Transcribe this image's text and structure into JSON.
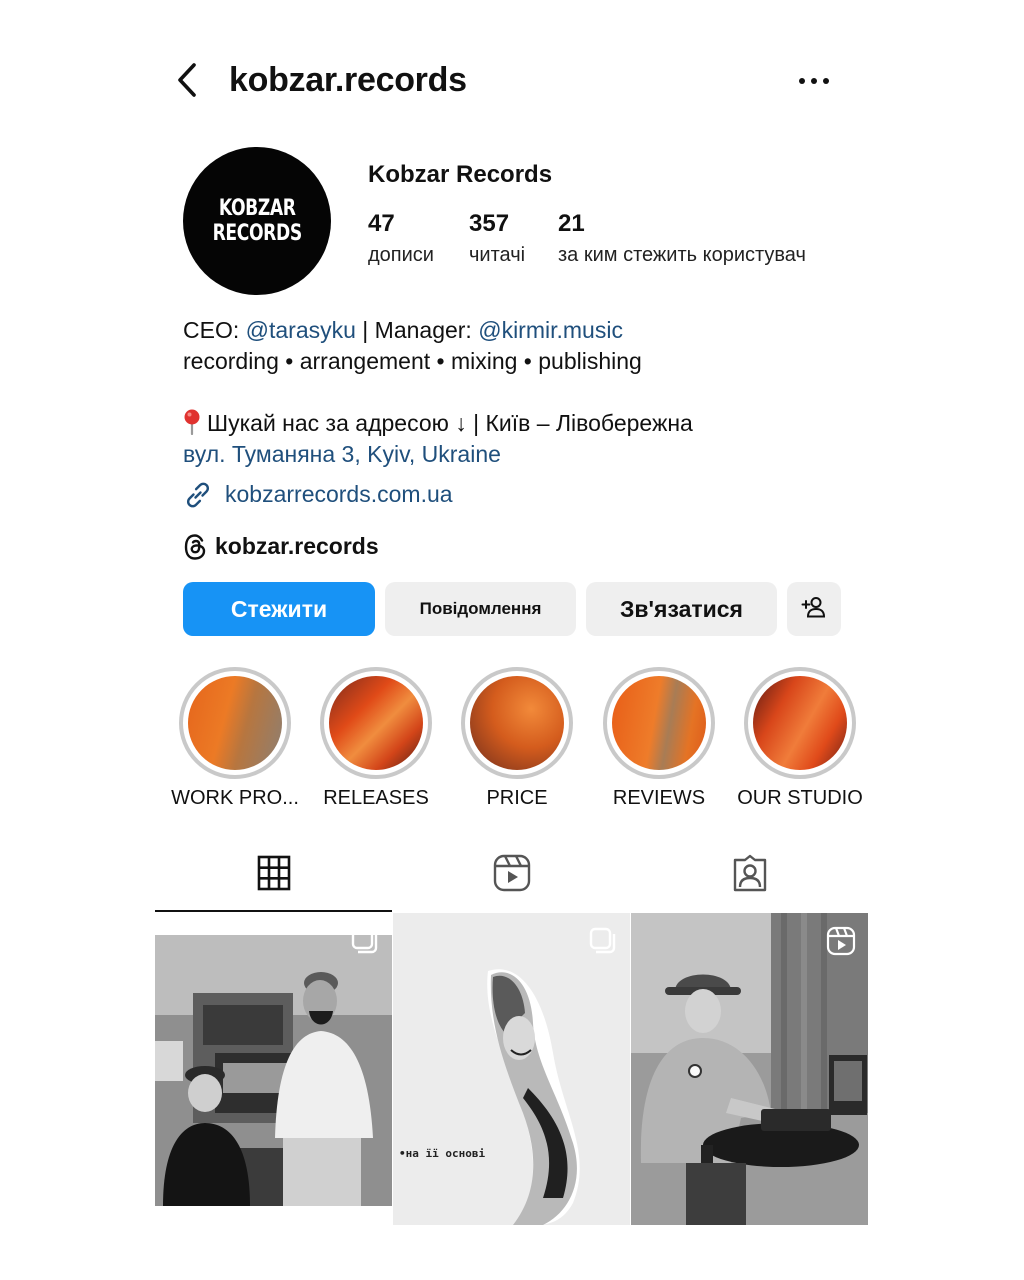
{
  "header": {
    "username": "kobzar.records"
  },
  "profile": {
    "avatar_text_line1": "KOBZAR",
    "avatar_text_line2": "RECORDS",
    "display_name": "Kobzar Records",
    "stats": [
      {
        "value": "47",
        "label": "дописи"
      },
      {
        "value": "357",
        "label": "читачі"
      },
      {
        "value": "21",
        "label": "за ким стежить користувач"
      }
    ]
  },
  "bio": {
    "line1_prefix": "CEO: ",
    "ceo_mention": "@tarasyku",
    "line1_middle": " | Manager: ",
    "manager_mention": "@kirmir.music",
    "line2": "recording • arrangement • mixing • publishing",
    "line3": "Шукай нас за адресою ↓ | Київ – Лівобережна",
    "address": "вул. Туманяна 3, Kyiv, Ukraine",
    "website": "kobzarrecords.com.ua",
    "threads_handle": "kobzar.records"
  },
  "buttons": {
    "follow": "Стежити",
    "message": "Повідомлення",
    "contact": "Зв'язатися"
  },
  "highlights": [
    {
      "label": "WORK PRO..."
    },
    {
      "label": "RELEASES"
    },
    {
      "label": "PRICE"
    },
    {
      "label": "REVIEWS"
    },
    {
      "label": "OUR STUDIO"
    }
  ],
  "tabs": {
    "active": "grid",
    "icons": [
      "grid-icon",
      "reels-icon",
      "tagged-icon"
    ]
  },
  "posts": [
    {
      "type": "carousel",
      "badge": "carousel-icon"
    },
    {
      "type": "carousel",
      "badge": "carousel-icon",
      "caption": "•на її основі"
    },
    {
      "type": "reel",
      "badge": "reels-icon"
    }
  ],
  "colors": {
    "accent_blue": "#1793f5",
    "link_blue": "#1f4f7c",
    "button_gray": "#efefef",
    "pin_red": "#e0322f"
  }
}
